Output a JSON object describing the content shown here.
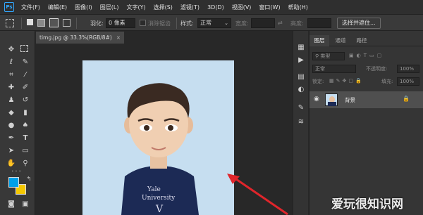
{
  "app": {
    "logo": "Ps"
  },
  "menu": [
    "文件(F)",
    "编辑(E)",
    "图像(I)",
    "图层(L)",
    "文字(Y)",
    "选择(S)",
    "滤镜(T)",
    "3D(D)",
    "视图(V)",
    "窗口(W)",
    "帮助(H)"
  ],
  "options": {
    "feather_label": "羽化:",
    "feather_value": "0 像素",
    "antialias_label": "消除锯齿",
    "style_label": "样式:",
    "style_value": "正常",
    "width_label": "宽度:",
    "height_label": "高度:",
    "select_mask_button": "选择并遮住..."
  },
  "document": {
    "tab_title": "timg.jpg @ 33.3%(RGB/8#)",
    "close_glyph": "×"
  },
  "layers_panel": {
    "tabs": [
      "图层",
      "通道",
      "路径"
    ],
    "filter_label": "类型",
    "blend_mode": "正常",
    "opacity_label": "不透明度:",
    "opacity_value": "100%",
    "lock_label": "锁定:",
    "fill_label": "填充:",
    "fill_value": "100%",
    "layer_name": "背景"
  },
  "colors": {
    "foreground": "#00a0e9",
    "background": "#f5c800",
    "canvas_bg": "#c6def0",
    "annotation_arrow": "#e0252b"
  },
  "watermark": "爱玩很知识网"
}
